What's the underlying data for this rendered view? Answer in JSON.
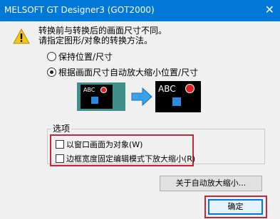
{
  "window": {
    "title": "MELSOFT GT Designer3 (GOT2000)",
    "close_glyph": "✕",
    "accent_color": "#0078d7",
    "highlight_color": "#c0283c"
  },
  "message": {
    "line1": "转换前与转换后的画面尺寸不同。",
    "line2": "请指定图形/对象的转换方法。",
    "icon": "warning-icon"
  },
  "options": [
    {
      "label": "保持位置/尺寸",
      "checked": false
    },
    {
      "label": "根据画面尺寸自动放大缩小位置/尺寸",
      "checked": true
    }
  ],
  "preview": {
    "small_text": "ABC",
    "large_text": "ABC"
  },
  "group": {
    "label": "选项",
    "checkboxes": [
      {
        "label": "以窗口画面为对象(W)",
        "checked": false
      },
      {
        "label": "边框宽度固定编辑模式下放大缩小(R)",
        "checked": false
      }
    ]
  },
  "buttons": {
    "auto_scale": "关于自动放大缩小...",
    "ok": "确定"
  }
}
